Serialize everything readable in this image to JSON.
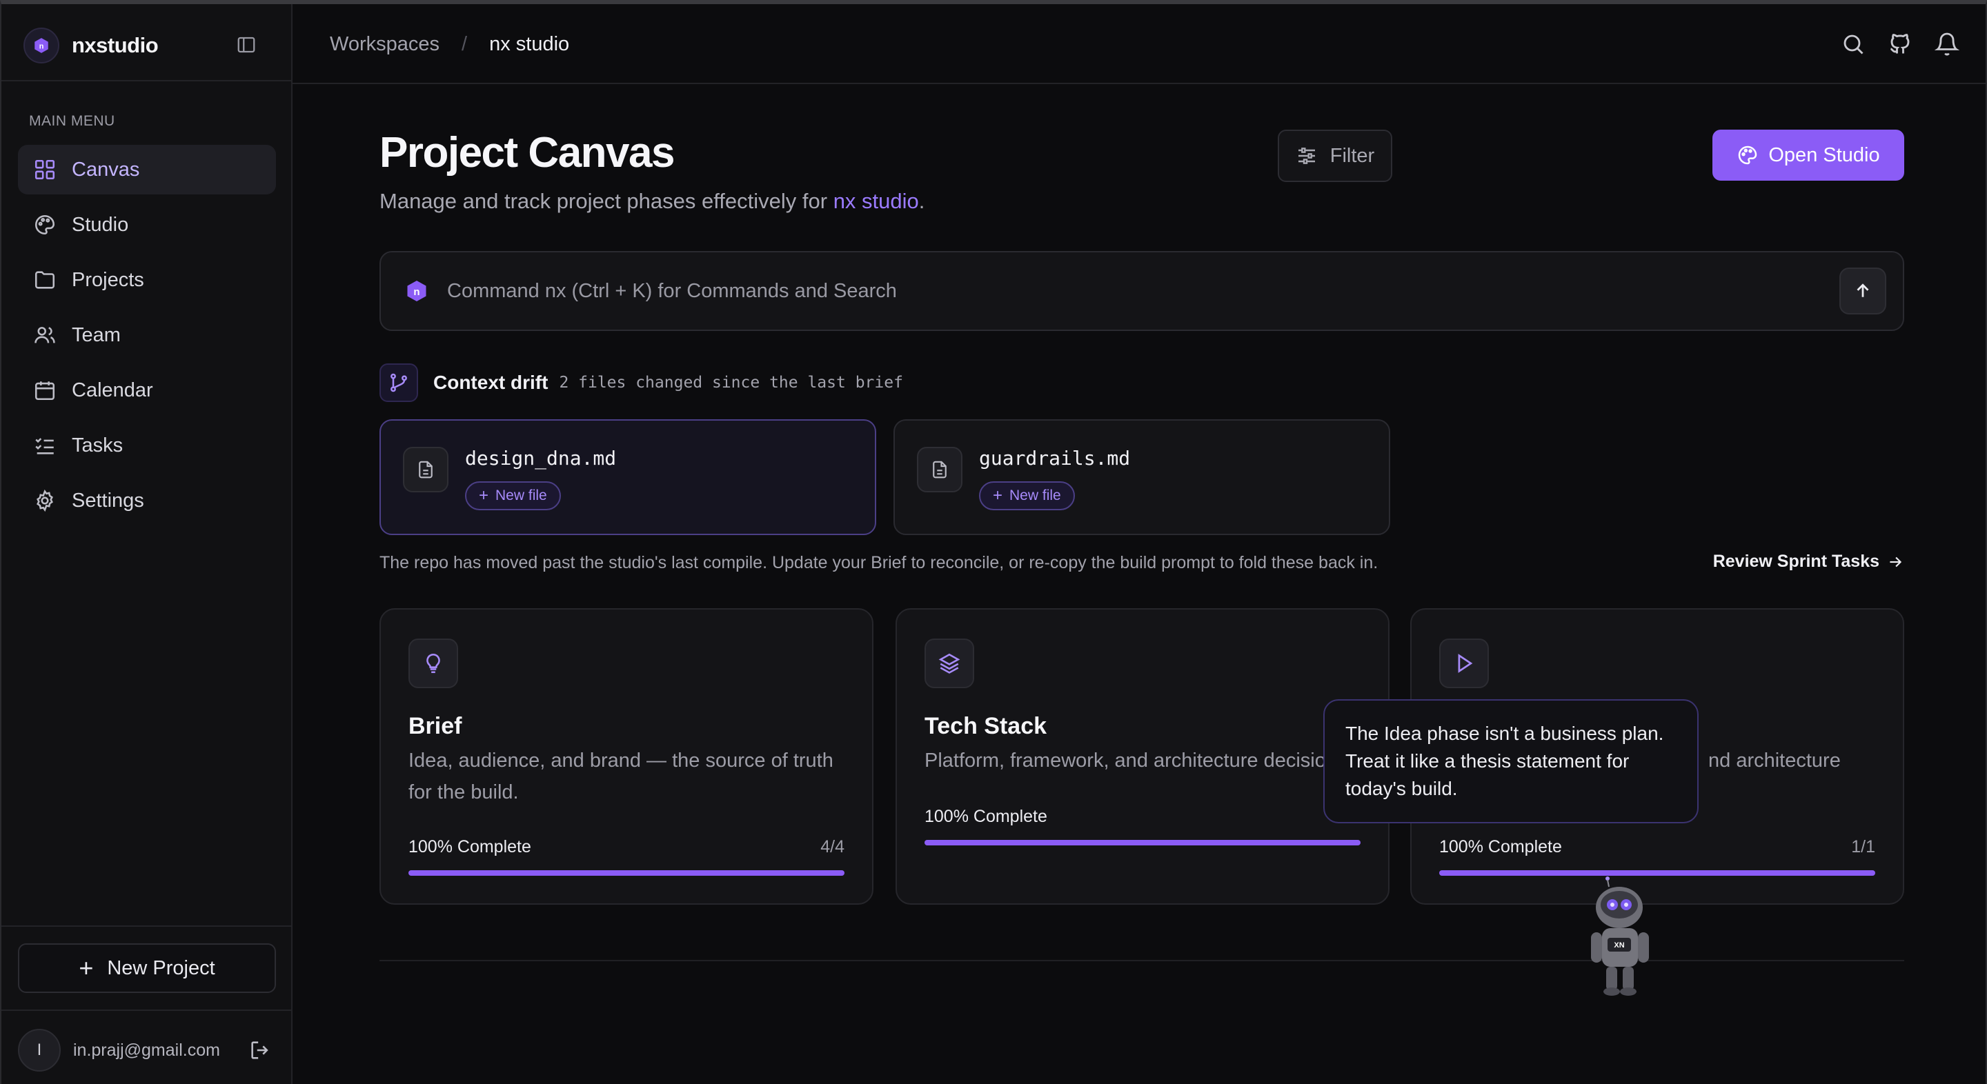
{
  "app": {
    "name": "nxstudio"
  },
  "sidebar": {
    "menu_heading": "MAIN MENU",
    "items": [
      {
        "label": "Canvas",
        "icon": "grid-icon",
        "active": true
      },
      {
        "label": "Studio",
        "icon": "palette-icon",
        "active": false
      },
      {
        "label": "Projects",
        "icon": "folder-icon",
        "active": false
      },
      {
        "label": "Team",
        "icon": "users-icon",
        "active": false
      },
      {
        "label": "Calendar",
        "icon": "calendar-icon",
        "active": false
      },
      {
        "label": "Tasks",
        "icon": "list-checks-icon",
        "active": false
      },
      {
        "label": "Settings",
        "icon": "gear-icon",
        "active": false
      }
    ],
    "new_project_label": "New Project",
    "user": {
      "initial": "I",
      "email": "in.prajj@gmail.com"
    }
  },
  "breadcrumb": {
    "root": "Workspaces",
    "separator": "/",
    "current": "nx studio"
  },
  "header": {
    "title": "Project Canvas",
    "subtitle_prefix": "Manage and track project phases effectively for ",
    "subtitle_highlight": "nx studio",
    "subtitle_suffix": ".",
    "filter_label": "Filter",
    "open_studio_label": "Open Studio"
  },
  "command": {
    "placeholder": "Command nx (Ctrl + K) for Commands and Search"
  },
  "drift": {
    "title": "Context drift",
    "meta": "2 files changed since the last brief",
    "files": [
      {
        "name": "design_dna.md",
        "badge": "New file",
        "selected": true
      },
      {
        "name": "guardrails.md",
        "badge": "New file",
        "selected": false
      }
    ],
    "note": "The repo has moved past the studio's last compile. Update your Brief to reconcile, or re-copy the build prompt to fold these back in.",
    "review_link": "Review Sprint Tasks"
  },
  "phases": [
    {
      "title": "Brief",
      "icon": "lightbulb-icon",
      "description": "Idea, audience, and brand — the source of truth for the build.",
      "progress_label": "100% Complete",
      "count": "4/4",
      "progress": 1.0
    },
    {
      "title": "Tech Stack",
      "icon": "layers-icon",
      "description": "Platform, framework, and architecture decisions.",
      "progress_label": "100% Complete",
      "count": "",
      "progress": 1.0
    },
    {
      "title": "",
      "icon": "play-icon",
      "description": "nd architecture",
      "progress_label": "100% Complete",
      "count": "1/1",
      "progress": 1.0
    }
  ],
  "tooltip": {
    "text": "The Idea phase isn't a business plan. Treat it like a thesis statement for today's build."
  },
  "mascot": {
    "chest_label": "XN"
  },
  "colors": {
    "accent": "#8b5cf6",
    "accent_text": "#9b7bff",
    "background": "#0c0c0e"
  }
}
